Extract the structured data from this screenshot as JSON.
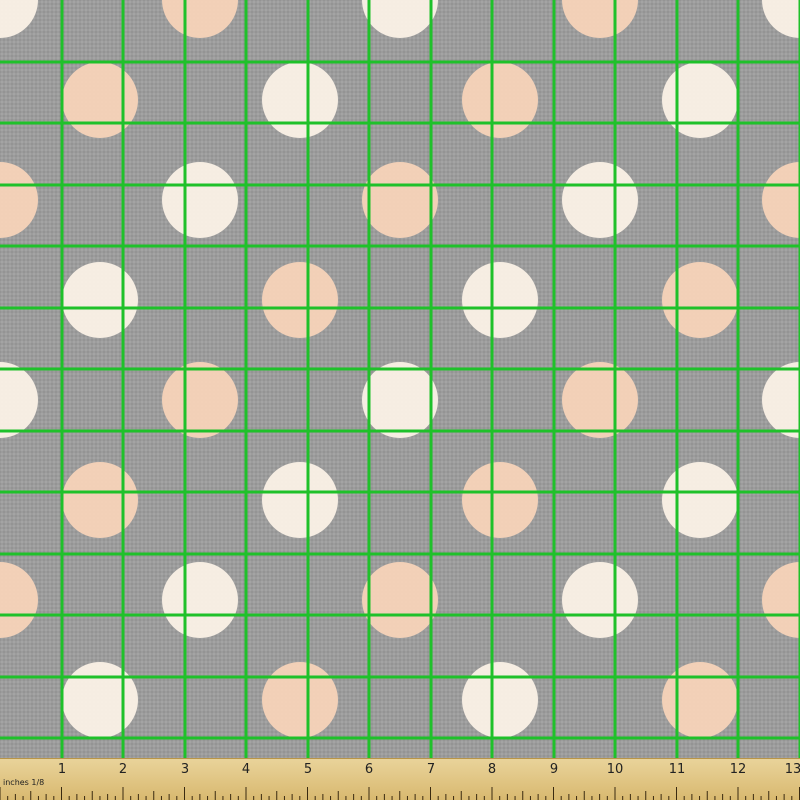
{
  "pattern": {
    "background_color": "#9c9c9c",
    "grid_color": "#1fc12a",
    "dot_colors": [
      "#fbf1e6",
      "#f4cfe0",
      "#f3c6c6",
      "#f7d3b8",
      "#fbe8ee",
      "#e9b6c4"
    ]
  },
  "ruler": {
    "caption": "inches 1/8",
    "labels": [
      "1",
      "2",
      "3",
      "4",
      "5",
      "6",
      "7",
      "8",
      "9",
      "10",
      "11",
      "12",
      "13"
    ]
  }
}
